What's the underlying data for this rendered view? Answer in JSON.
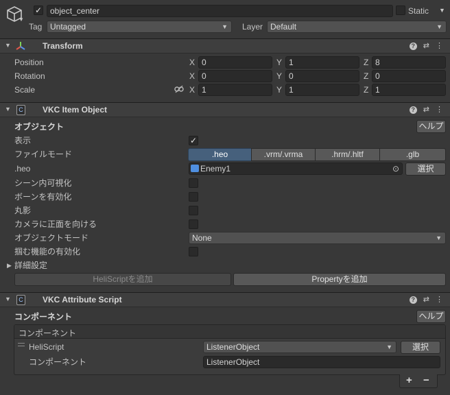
{
  "object_header": {
    "name": "object_center",
    "active_checked": true,
    "static_label": "Static",
    "tag_label": "Tag",
    "tag_value": "Untagged",
    "layer_label": "Layer",
    "layer_value": "Default"
  },
  "transform": {
    "title": "Transform",
    "position_label": "Position",
    "rotation_label": "Rotation",
    "scale_label": "Scale",
    "axis_x": "X",
    "axis_y": "Y",
    "axis_z": "Z",
    "position": {
      "x": "0",
      "y": "1",
      "z": "8"
    },
    "rotation": {
      "x": "0",
      "y": "0",
      "z": "0"
    },
    "scale": {
      "x": "1",
      "y": "1",
      "z": "1"
    }
  },
  "vkc_item": {
    "title": "VKC Item Object",
    "section_label": "オブジェクト",
    "help_button": "ヘルプ",
    "display_label": "表示",
    "display_checked": true,
    "file_mode_label": "ファイルモード",
    "file_mode_options": [
      ".heo",
      ".vrm/.vrma",
      ".hrm/.hltf",
      ".glb"
    ],
    "file_mode_selected": ".heo",
    "heo_label": ".heo",
    "heo_value": "Enemy1",
    "select_button": "選択",
    "scene_visible_label": "シーン内可視化",
    "bone_enable_label": "ボーンを有効化",
    "round_shadow_label": "丸影",
    "face_camera_label": "カメラに正面を向ける",
    "object_mode_label": "オブジェクトモード",
    "object_mode_value": "None",
    "grab_enable_label": "掴む機能の有効化",
    "advanced_label": "詳細設定",
    "add_heliscript_button": "HeliScriptを追加",
    "add_property_button": "Propertyを追加"
  },
  "vkc_attr": {
    "title": "VKC Attribute Script",
    "section_label": "コンポーネント",
    "help_button": "ヘルプ",
    "list_header": "コンポーネント",
    "heliscript_label": "HeliScript",
    "heliscript_value": "ListenerObject",
    "select_button": "選択",
    "component_label": "コンポーネント",
    "component_value": "ListenerObject",
    "add_symbol": "+",
    "remove_symbol": "−"
  },
  "colors": {
    "background": "#383838",
    "header": "#3e3e3e",
    "field": "#2a2a2a",
    "segment_active": "#46607c"
  }
}
